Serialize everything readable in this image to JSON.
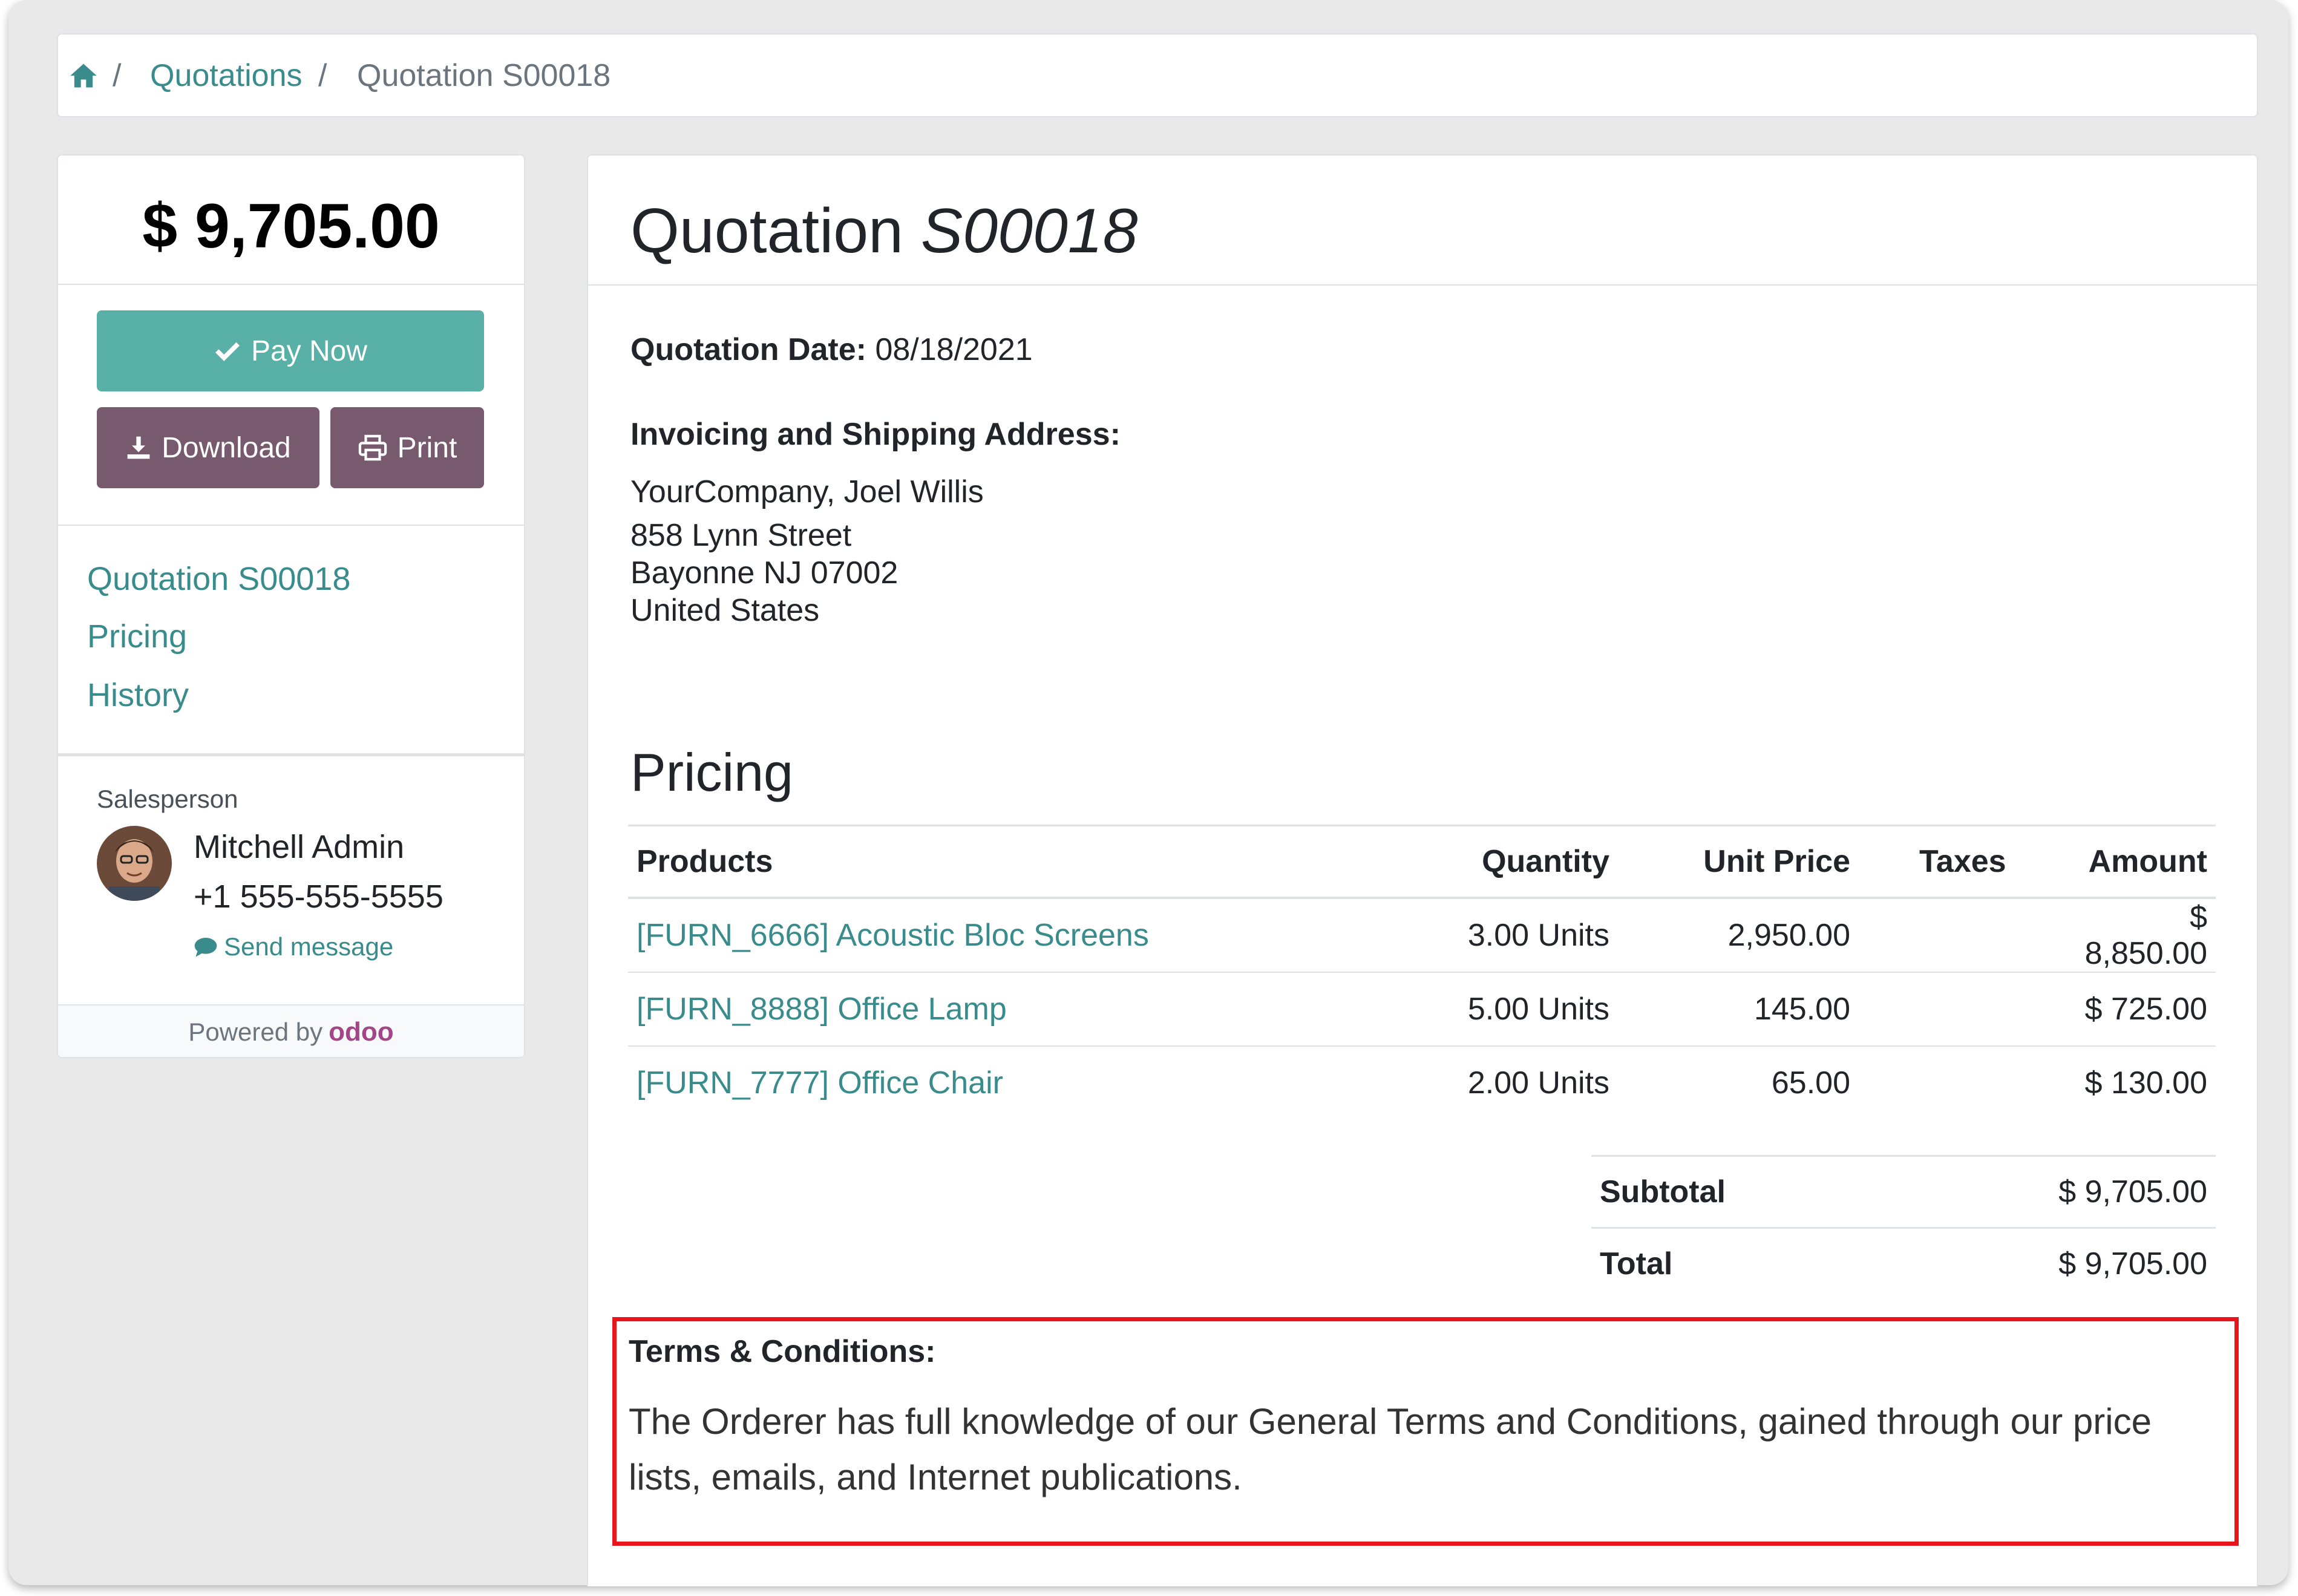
{
  "breadcrumb": {
    "home_icon": "home-icon",
    "separator": "/",
    "items": [
      "Quotations",
      "Quotation S00018"
    ]
  },
  "sidebar": {
    "amount": "$ 9,705.00",
    "pay_button": "Pay Now",
    "download_button": "Download",
    "print_button": "Print",
    "nav": [
      "Quotation S00018",
      "Pricing",
      "History"
    ],
    "salesperson_label": "Salesperson",
    "salesperson_name": "Mitchell Admin",
    "salesperson_phone": "+1 555-555-5555",
    "send_message": "Send message",
    "powered_by": "Powered by",
    "brand": "odoo"
  },
  "main": {
    "title_prefix": "Quotation",
    "title_number": "S00018",
    "date_label": "Quotation Date:",
    "date_value": "08/18/2021",
    "address_label": "Invoicing and Shipping Address:",
    "address_lines": [
      "YourCompany, Joel Willis",
      "858 Lynn Street",
      "Bayonne NJ 07002",
      "United States"
    ],
    "pricing_heading": "Pricing",
    "columns": [
      "Products",
      "Quantity",
      "Unit Price",
      "Taxes",
      "Amount"
    ],
    "rows": [
      {
        "product": "[FURN_6666] Acoustic Bloc Screens",
        "quantity": "3.00 Units",
        "unit_price": "2,950.00",
        "taxes": "",
        "amount": "$ 8,850.00"
      },
      {
        "product": "[FURN_8888] Office Lamp",
        "quantity": "5.00 Units",
        "unit_price": "145.00",
        "taxes": "",
        "amount": "$ 725.00"
      },
      {
        "product": "[FURN_7777] Office Chair",
        "quantity": "2.00 Units",
        "unit_price": "65.00",
        "taxes": "",
        "amount": "$ 130.00"
      }
    ],
    "subtotal_label": "Subtotal",
    "subtotal_value": "$ 9,705.00",
    "total_label": "Total",
    "total_value": "$ 9,705.00",
    "terms_title": "Terms & Conditions:",
    "terms_text": "The Orderer has full knowledge of our General Terms and Conditions, gained through our price lists, emails, and Internet publications."
  },
  "colors": {
    "link": "#3a8b8b",
    "pay_button": "#58b0a6",
    "secondary_button": "#785a6f",
    "highlight_border": "#e8161c"
  }
}
